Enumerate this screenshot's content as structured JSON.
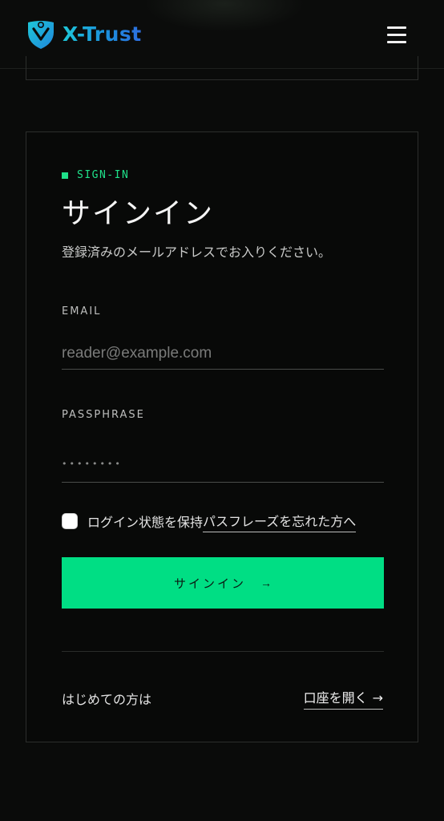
{
  "header": {
    "brand": "X-Trust",
    "logo_icon": "shield-person-icon",
    "menu_icon": "hamburger-menu-icon"
  },
  "signin": {
    "eyebrow": "SIGN-IN",
    "title": "サインイン",
    "subtitle": "登録済みのメールアドレスでお入りください。",
    "email_label": "EMAIL",
    "email_placeholder": "reader@example.com",
    "password_label": "PASSPHRASE",
    "password_dots": "••••••••",
    "remember_label": "ログイン状態を保持",
    "forgot_link": "パスフレーズを忘れた方へ",
    "submit_label": "サインイン",
    "submit_arrow": "→",
    "first_time_text": "はじめての方は",
    "open_account_link": "口座を開く",
    "open_account_arrow": "→"
  },
  "colors": {
    "accent": "#00de84",
    "background": "#0a0b0a",
    "brand_gradient_start": "#1ec7d8",
    "brand_gradient_end": "#2d6ee0"
  }
}
